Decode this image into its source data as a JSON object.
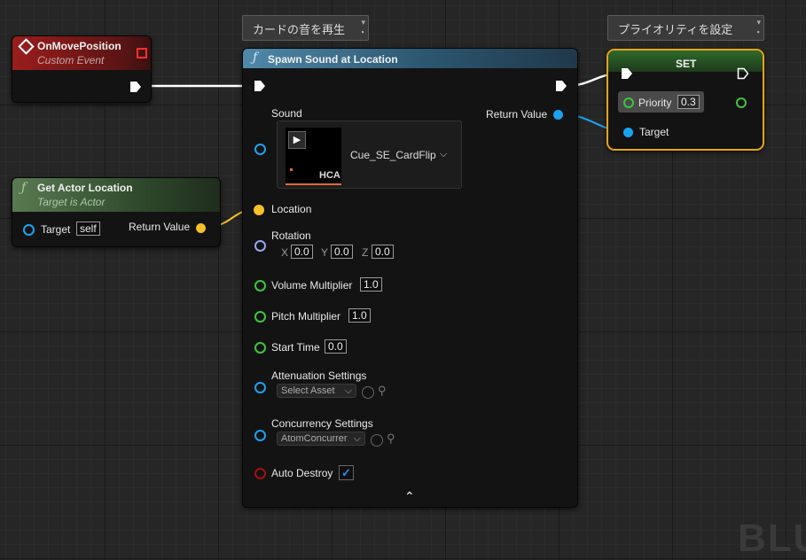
{
  "bubbles": {
    "spawn": "カードの音を再生",
    "set": "プライオリティを設定"
  },
  "event_node": {
    "title": "OnMovePosition",
    "subtitle": "Custom Event"
  },
  "get_actor": {
    "title": "Get Actor Location",
    "subtitle": "Target is Actor",
    "target_label": "Target",
    "target_value": "self",
    "return_label": "Return Value"
  },
  "spawn": {
    "title": "Spawn Sound at Location",
    "sound_label": "Sound",
    "sound_asset": "Cue_SE_CardFlip",
    "thumb_label": "HCA",
    "return_label": "Return Value",
    "location_label": "Location",
    "rotation_label": "Rotation",
    "rot": {
      "x_label": "X",
      "x": "0.0",
      "y_label": "Y",
      "y": "0.0",
      "z_label": "Z",
      "z": "0.0"
    },
    "volume_label": "Volume Multiplier",
    "volume": "1.0",
    "pitch_label": "Pitch Multiplier",
    "pitch": "1.0",
    "start_label": "Start Time",
    "start": "0.0",
    "atten_label": "Attenuation Settings",
    "atten_placeholder": "Select Asset",
    "conc_label": "Concurrency Settings",
    "conc_value": "AtomConcurrer",
    "auto_label": "Auto Destroy"
  },
  "set_node": {
    "title": "SET",
    "priority_label": "Priority",
    "priority_value": "0.3",
    "target_label": "Target"
  },
  "colors": {
    "exec": "#ffffff",
    "vector": "#f5c02a",
    "object": "#1aa3f0",
    "float": "#3ec43e",
    "bool": "#a41010",
    "rotator": "#9aa6f0",
    "selected": "#e8a317"
  },
  "watermark": "BLU"
}
